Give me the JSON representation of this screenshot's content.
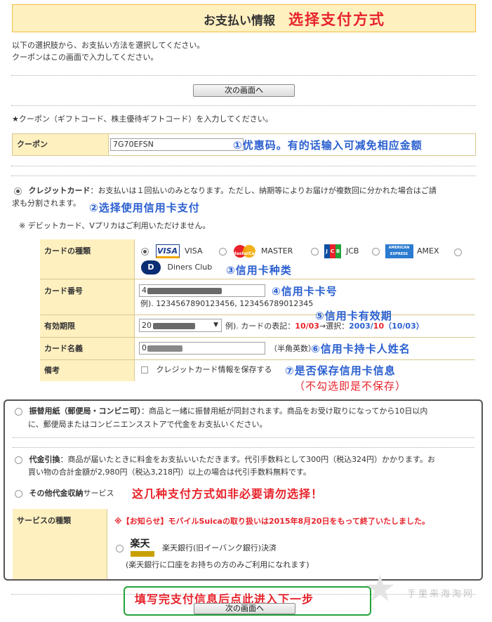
{
  "header": {
    "title_jp": "お支払い情報",
    "title_cn": "选择支付方式"
  },
  "intro": {
    "line1": "以下の選択肢から、お支払い方法を選択してください。",
    "line2": "クーポンはこの画面で入力してください。"
  },
  "next_button_top": "次の画面へ",
  "coupon": {
    "prompt": "★クーポン（ギフトコード、株主優待ギフトコード）を入力してください。",
    "label": "クーポン",
    "value": "7G70EFSN",
    "note": "①优惠码。有的话输入可减免相应金额"
  },
  "credit": {
    "option_label": "クレジットカード",
    "desc1": "：お支払いは１回払いのみとなります。ただし、納期等によりお届けが複数回に分かれた場合はご請",
    "desc2": "求も分割されます。",
    "note": "②选择使用信用卡支付",
    "debit_note": "※ デビットカード、Vプリカはご利用いただけません。",
    "rows": {
      "type_label": "カードの種類",
      "number_label": "カード番号",
      "expiry_label": "有効期限",
      "name_label": "カード名義",
      "remarks_label": "備考"
    },
    "brands": [
      {
        "name": "VISA",
        "logo": "VISA"
      },
      {
        "name": "MASTER",
        "logo": "MasterCard"
      },
      {
        "name": "JCB",
        "logo": "JCB"
      },
      {
        "name": "AMEX",
        "logo": "AMERICAN EXPRESS"
      },
      {
        "name": "Diners Club",
        "logo": "D"
      }
    ],
    "type_note": "③信用卡种类",
    "number_prefix": "4",
    "number_example": "例). 1234567890123456, 123456789012345",
    "number_note": "④信用卡卡号",
    "expiry_note": "⑤信用卡有效期",
    "expiry_value_prefix": "20",
    "expiry_example_pre": "例). カードの表記：",
    "expiry_example_card": "10/03",
    "expiry_example_arrow": "→選択：",
    "expiry_example_year": "2003/",
    "expiry_example_month": "10",
    "expiry_example_paren": "（10/03）",
    "name_value_prefix": "0",
    "name_hint": "（半角英数）",
    "name_note": "⑥信用卡持卡人姓名",
    "save_label": "クレジットカード情報を保存する",
    "save_note": "⑦是否保存信用卡信息",
    "save_subnote": "（不勾选即是不保存）"
  },
  "other_methods": {
    "furikae_label": "振替用紙（郵便局・コンビニ可）",
    "furikae_desc1": "：商品と一緒に振替用紙が同封されます。商品をお受け取りになってから10日以内",
    "furikae_desc2": "に、郵便局またはコンビニエンスストアで代金をお支払いください。",
    "daibiki_label": "代金引換",
    "daibiki_desc1": "：商品が届いたときに料金をお支払いいただきます。代引手数料として300円（税込324円）かかります。お",
    "daibiki_desc2": "買い物の合計金額が2,980円（税込3,218円）以上の場合は代引手数料無料です。",
    "other_label": "その他代金収納",
    "other_suffix": "サービス",
    "warning_note": "这几种支付方式如非必要请勿选择！",
    "service_label": "サービスの種類",
    "notice": "※【お知らせ】モバイルSuicaの取り扱いは2015年8月20日をもって終了いたしました。",
    "rakuten_name": "楽天銀行(旧イーバンク銀行)決済",
    "rakuten_logo": "楽天",
    "rakuten_note": "(楽天銀行に口座をお持ちの方のみご利用になれます)"
  },
  "footer": {
    "next_note": "填写完支付信息后点此进入下一步",
    "next_button": "次の画面へ",
    "watermark": "手里来海淘网"
  },
  "colors": {
    "header_bg": "#fff0c0",
    "header_border": "#f0c040",
    "annotation_red": "#e8232b",
    "annotation_blue": "#2a5fd0",
    "green_box": "#23a23a"
  }
}
